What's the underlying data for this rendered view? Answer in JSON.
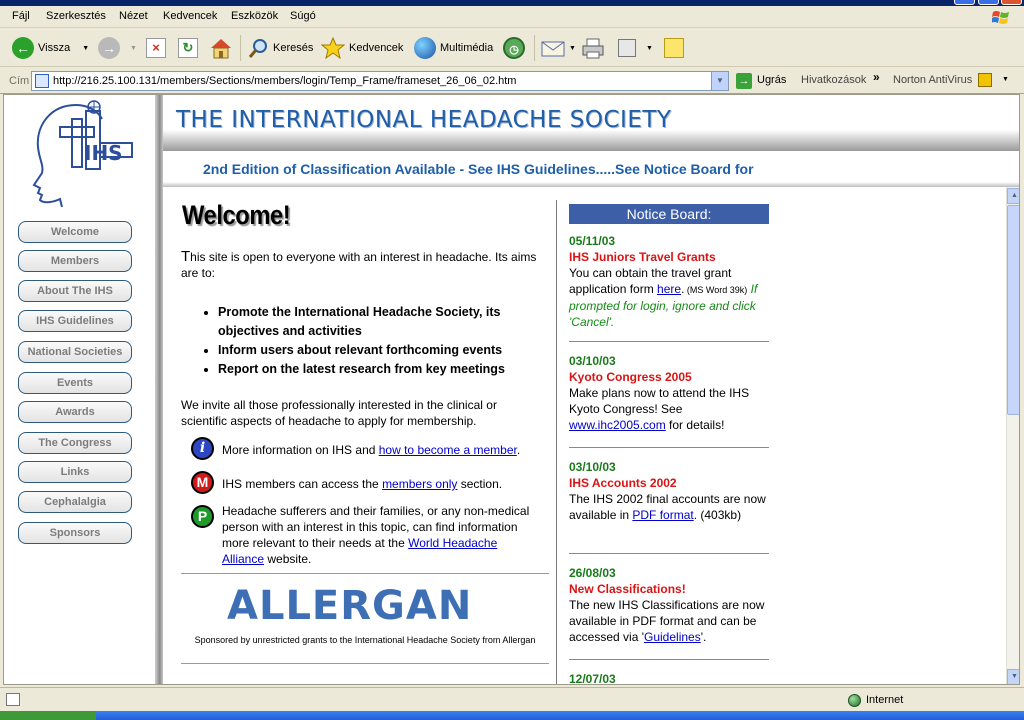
{
  "menubar": {
    "items": [
      "Fájl",
      "Szerkesztés",
      "Nézet",
      "Kedvencek",
      "Eszközök",
      "Súgó"
    ]
  },
  "toolbar": {
    "back_label": "Vissza",
    "search_label": "Keresés",
    "favorites_label": "Kedvencek",
    "media_label": "Multimédia"
  },
  "address": {
    "label": "Cím",
    "url": "http://216.25.100.131/members/Sections/members/login/Temp_Frame/frameset_26_06_02.htm",
    "go_label": "Ugrás",
    "links_label": "Hivatkozások",
    "chevron": "»",
    "norton_label": "Norton AntiVirus"
  },
  "header": {
    "title": "THE INTERNATIONAL HEADACHE SOCIETY",
    "marquee": "2nd Edition of Classification Available - See IHS Guidelines.....See Notice Board for"
  },
  "logo": {
    "text": "IHS"
  },
  "nav": {
    "items": [
      "Welcome",
      "Members",
      "About The IHS",
      "IHS Guidelines",
      "National Societies",
      "Events",
      "Awards",
      "The Congress",
      "Links",
      "Cephalalgia",
      "Sponsors"
    ]
  },
  "main": {
    "title": "Welcome!",
    "intro_cap": "T",
    "intro_rest": "his site is open to everyone with an interest in headache. Its aims are to:",
    "bullets": [
      "Promote the International Headache Society, its objectives and activities",
      "Inform users about relevant forthcoming events",
      "Report on the latest research from key meetings"
    ],
    "invite": "We invite all those professionally interested in the clinical or scientific aspects of headache to apply for membership.",
    "info1_pre": "More information on IHS and ",
    "info1_link": "how to become a member",
    "info1_post": ".",
    "info1_icon": "i",
    "info2_pre": "IHS members can access the ",
    "info2_link": "members only",
    "info2_post": " section.",
    "info2_icon": "M",
    "info3_pre": "Headache sufferers and their families, or any non-medical person with an interest in this topic, can find information more relevant to their needs at the ",
    "info3_link": "World Headache Alliance",
    "info3_post": " website.",
    "info3_icon": "P",
    "sponsor_logo": "ALLERGAN",
    "sponsor_note": "Sponsored by unrestricted grants to the International Headache Society from Allergan"
  },
  "notice": {
    "title": "Notice Board:",
    "e1": {
      "date": "05/11/03",
      "head": "IHS Juniors Travel Grants",
      "pre": "You can obtain the travel grant application form ",
      "link": "here",
      "post": ".",
      "small": " (MS Word 39k)",
      "italic": " If prompted for login, ignore and click 'Cancel'."
    },
    "e2": {
      "date": "03/10/03",
      "head": "Kyoto Congress 2005",
      "pre": "Make plans now to attend the IHS Kyoto Congress! See ",
      "link": "www.ihc2005.com",
      "post": " for details!"
    },
    "e3": {
      "date": "03/10/03",
      "head": "IHS Accounts 2002",
      "pre": "The IHS 2002 final accounts are now available in ",
      "link": "PDF format",
      "post": ". (403kb)"
    },
    "e4": {
      "date": "26/08/03",
      "head": "New Classifications!",
      "pre": "The new IHS Classifications are now available in PDF format and can be accessed via '",
      "link": "Guidelines",
      "post": "'."
    },
    "e5": {
      "date": "12/07/03"
    }
  },
  "status": {
    "zone": "Internet"
  },
  "colors": {
    "accent": "#1f5fa9",
    "notice_header": "#3d5fa8",
    "date_green": "#1a7a1a",
    "headline_red": "#d91414"
  }
}
